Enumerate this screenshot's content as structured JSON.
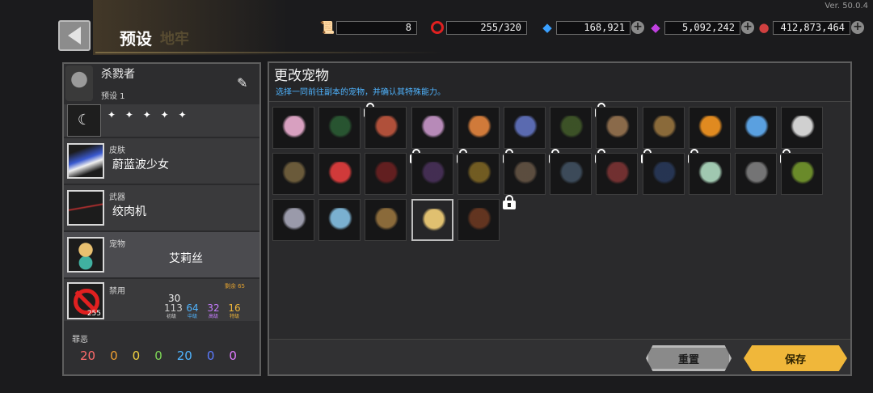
{
  "version": "Ver. 50.0.4",
  "header": {
    "title": "预设",
    "title_ghost": "地牢"
  },
  "resources": [
    {
      "name": "scroll",
      "icon": "scroll-icon",
      "value": "8"
    },
    {
      "name": "ban",
      "icon": "ban-icon",
      "value": "255/320"
    },
    {
      "name": "gems",
      "icon": "gem-icon",
      "value": "168,921"
    },
    {
      "name": "crystals",
      "icon": "crystal-icon",
      "value": "5,092,242"
    },
    {
      "name": "materials",
      "icon": "material-icon",
      "value": "412,873,464"
    }
  ],
  "loadout": {
    "hero_name": "杀戮者",
    "preset": "预设 1",
    "skin": {
      "category": "皮肤",
      "value": "蔚蓝波少女"
    },
    "weapon": {
      "category": "武器",
      "value": "绞肉机"
    },
    "pet": {
      "category": "宠物",
      "value": "艾莉丝"
    },
    "ban": {
      "category": "禁用",
      "icon_count": "255",
      "remaining": "剩余 65",
      "total": "30",
      "tiers": [
        {
          "value": "113",
          "label": "初级",
          "color": "#cfcfcf"
        },
        {
          "value": "64",
          "label": "中级",
          "color": "#4fb4ff"
        },
        {
          "value": "32",
          "label": "高级",
          "color": "#c77dff"
        },
        {
          "value": "16",
          "label": "特级",
          "color": "#f0b73a"
        }
      ]
    },
    "sins": {
      "label": "罪恶",
      "values": [
        {
          "v": "20",
          "color": "#ff6b6b"
        },
        {
          "v": "0",
          "color": "#f0a030"
        },
        {
          "v": "0",
          "color": "#f0d040"
        },
        {
          "v": "0",
          "color": "#7ed957"
        },
        {
          "v": "20",
          "color": "#4fb4ff"
        },
        {
          "v": "0",
          "color": "#5b7bff"
        },
        {
          "v": "0",
          "color": "#e07bff"
        }
      ]
    }
  },
  "pet_panel": {
    "title": "更改宠物",
    "subtitle": "选择一同前往副本的宠物，并确认其特殊能力。",
    "pets": [
      {
        "icon": "potion-pet-icon",
        "color": "#d8a0c0",
        "locked": false
      },
      {
        "icon": "cactus-pet-icon",
        "color": "#3fa050",
        "locked": true
      },
      {
        "icon": "bird-pet-icon",
        "color": "#b0503a",
        "locked": false
      },
      {
        "icon": "squid-pet-icon",
        "color": "#b78ab8",
        "locked": false
      },
      {
        "icon": "fox-pet-icon",
        "color": "#d07a3a",
        "locked": false
      },
      {
        "icon": "ghost-pet-icon",
        "color": "#5a6ab0",
        "locked": false
      },
      {
        "icon": "plant-pet-icon",
        "color": "#6a9a3a",
        "locked": true
      },
      {
        "icon": "golem-pet-icon",
        "color": "#8a6a4a",
        "locked": false
      },
      {
        "icon": "chest-pet-icon",
        "color": "#8a6a3a",
        "locked": false
      },
      {
        "icon": "pumpkin-pet-icon",
        "color": "#e08a20",
        "locked": false
      },
      {
        "icon": "lifebuoy-pet-icon",
        "color": "#5aa0e0",
        "locked": false
      },
      {
        "icon": "wolf-pet-icon",
        "color": "#d0d0d0",
        "locked": false
      },
      {
        "icon": "log-pet-icon",
        "color": "#6a5a3a",
        "locked": false
      },
      {
        "icon": "mushroom-pet-icon",
        "color": "#d03a3a",
        "locked": false
      },
      {
        "icon": "demon-mask-pet-icon",
        "color": "#c02a2a",
        "locked": true
      },
      {
        "icon": "boar-pet-icon",
        "color": "#7a4a9a",
        "locked": true
      },
      {
        "icon": "sun-pet-icon",
        "color": "#e0b030",
        "locked": true
      },
      {
        "icon": "eagle-pet-icon",
        "color": "#b09070",
        "locked": true
      },
      {
        "icon": "shark-pet-icon",
        "color": "#6a8aaa",
        "locked": true
      },
      {
        "icon": "squirrel-pet-icon",
        "color": "#e05050",
        "locked": true
      },
      {
        "icon": "dragon-pet-icon",
        "color": "#3a5a9a",
        "locked": true
      },
      {
        "icon": "egg-pet-icon",
        "color": "#a0c8b0",
        "locked": false
      },
      {
        "icon": "snowman-pet-icon",
        "color": "#e8e8e8",
        "locked": true
      },
      {
        "icon": "pumpkin-head-pet-icon",
        "color": "#6a8a2a",
        "locked": false
      },
      {
        "icon": "witch-pet-icon",
        "color": "#9a9aaa",
        "locked": false
      },
      {
        "icon": "jellyfish-pet-icon",
        "color": "#7ab0d0",
        "locked": false
      },
      {
        "icon": "scarecrow-pet-icon",
        "color": "#8a6a3a",
        "locked": false
      },
      {
        "icon": "mermaid-pet-icon",
        "color": "#e0c070",
        "locked": false,
        "selected": true
      },
      {
        "icon": "carrot-pet-icon",
        "color": "#c05a2a",
        "locked": true
      }
    ]
  },
  "buttons": {
    "reset": "重置",
    "save": "保存"
  }
}
